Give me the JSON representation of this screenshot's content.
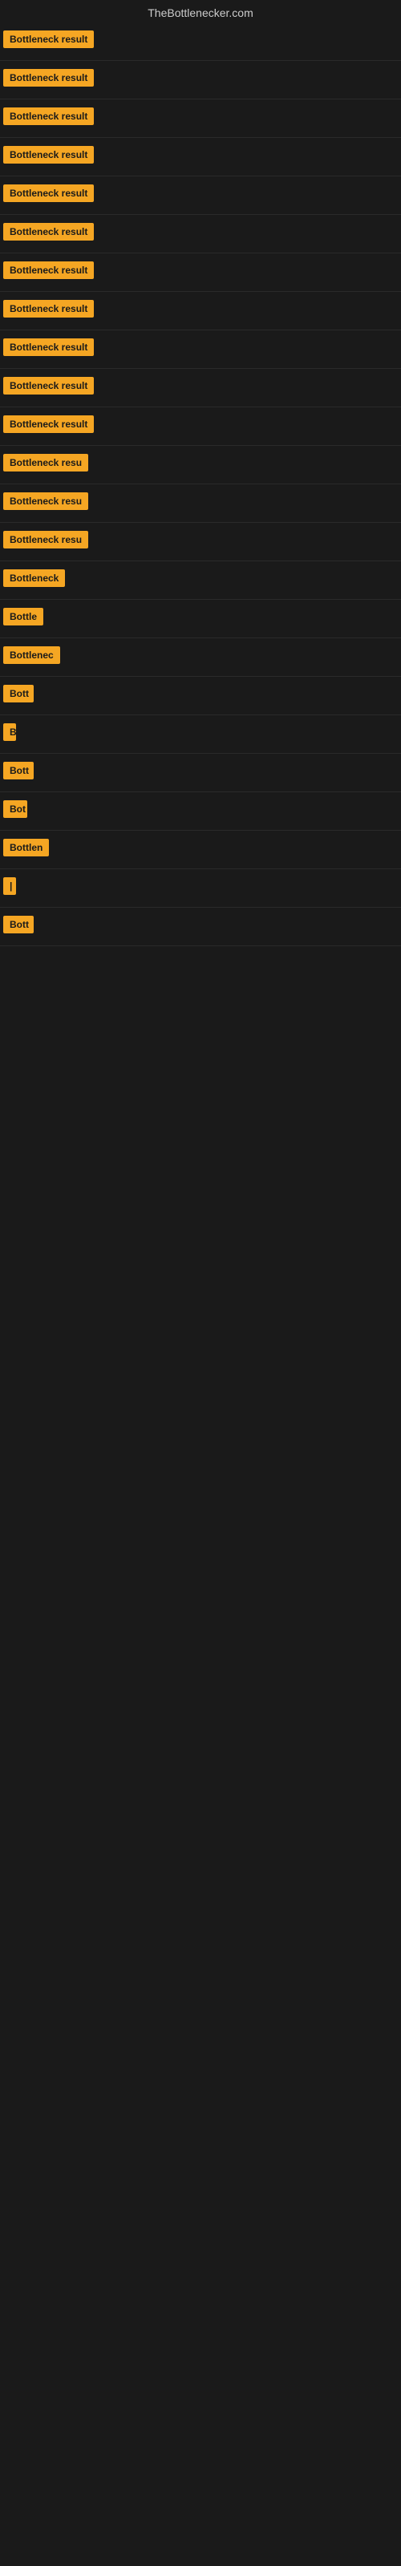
{
  "site": {
    "title": "TheBottlenecker.com"
  },
  "results": [
    {
      "id": 1,
      "label": "Bottleneck result",
      "width": 130
    },
    {
      "id": 2,
      "label": "Bottleneck result",
      "width": 130
    },
    {
      "id": 3,
      "label": "Bottleneck result",
      "width": 130
    },
    {
      "id": 4,
      "label": "Bottleneck result",
      "width": 130
    },
    {
      "id": 5,
      "label": "Bottleneck result",
      "width": 130
    },
    {
      "id": 6,
      "label": "Bottleneck result",
      "width": 130
    },
    {
      "id": 7,
      "label": "Bottleneck result",
      "width": 130
    },
    {
      "id": 8,
      "label": "Bottleneck result",
      "width": 130
    },
    {
      "id": 9,
      "label": "Bottleneck result",
      "width": 130
    },
    {
      "id": 10,
      "label": "Bottleneck result",
      "width": 130
    },
    {
      "id": 11,
      "label": "Bottleneck result",
      "width": 125
    },
    {
      "id": 12,
      "label": "Bottleneck resu",
      "width": 110
    },
    {
      "id": 13,
      "label": "Bottleneck resu",
      "width": 108
    },
    {
      "id": 14,
      "label": "Bottleneck resu",
      "width": 106
    },
    {
      "id": 15,
      "label": "Bottleneck",
      "width": 80
    },
    {
      "id": 16,
      "label": "Bottle",
      "width": 52
    },
    {
      "id": 17,
      "label": "Bottlenec",
      "width": 72
    },
    {
      "id": 18,
      "label": "Bott",
      "width": 38
    },
    {
      "id": 19,
      "label": "B",
      "width": 14
    },
    {
      "id": 20,
      "label": "Bott",
      "width": 38
    },
    {
      "id": 21,
      "label": "Bot",
      "width": 30
    },
    {
      "id": 22,
      "label": "Bottlen",
      "width": 58
    },
    {
      "id": 23,
      "label": "|",
      "width": 8
    },
    {
      "id": 24,
      "label": "Bott",
      "width": 38
    }
  ]
}
